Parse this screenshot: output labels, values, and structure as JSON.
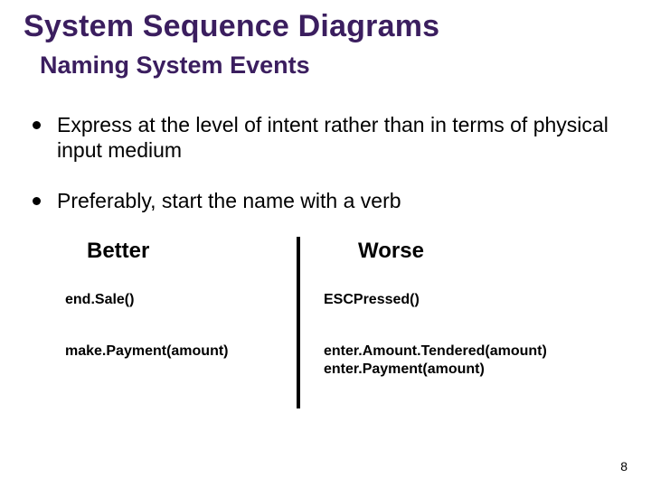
{
  "title": "System Sequence Diagrams",
  "subtitle": "Naming System Events",
  "bullets": [
    "Express at the level of intent rather than in terms of physical input medium",
    "Preferably, start the name with a verb"
  ],
  "compare": {
    "better": {
      "heading": "Better",
      "items": [
        "end.Sale()",
        "make.Payment(amount)"
      ]
    },
    "worse": {
      "heading": "Worse",
      "items": [
        "ESCPressed()",
        "enter.Amount.Tendered(amount)\nenter.Payment(amount)"
      ]
    }
  },
  "page_number": "8"
}
